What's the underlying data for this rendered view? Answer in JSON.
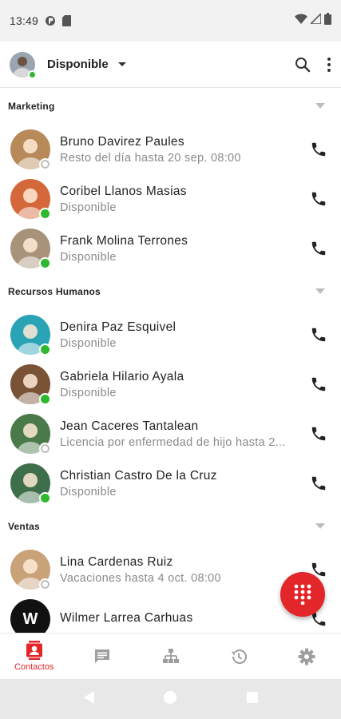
{
  "status_bar": {
    "time": "13:49"
  },
  "header": {
    "status": "Disponible"
  },
  "groups": [
    {
      "name": "Marketing",
      "contacts": [
        {
          "name": "Bruno Davirez Paules",
          "status": "Resto del día hasta 20 sep. 08:00",
          "presence": "off",
          "avatar_color": "#b88a5a"
        },
        {
          "name": "Coribel Llanos Masias",
          "status": "Disponible",
          "presence": "on",
          "avatar_color": "#d4683a"
        },
        {
          "name": "Frank Molina Terrones",
          "status": "Disponible",
          "presence": "on",
          "avatar_color": "#a8937a"
        }
      ]
    },
    {
      "name": "Recursos Humanos",
      "contacts": [
        {
          "name": "Denira Paz Esquivel",
          "status": "Disponible",
          "presence": "on",
          "avatar_color": "#2aa3b5"
        },
        {
          "name": "Gabriela Hilario Ayala",
          "status": "Disponible",
          "presence": "on",
          "avatar_color": "#7a5236"
        },
        {
          "name": "Jean Caceres Tantalean",
          "status": "Licencia por enfermedad de hijo hasta 2...",
          "presence": "off",
          "avatar_color": "#4a7a4a"
        },
        {
          "name": "Christian Castro De la Cruz",
          "status": "Disponible",
          "presence": "on",
          "avatar_color": "#3f6f4a"
        }
      ]
    },
    {
      "name": "Ventas",
      "contacts": [
        {
          "name": "Lina Cardenas Ruiz",
          "status": "Vacaciones hasta 4 oct. 08:00",
          "presence": "off",
          "avatar_color": "#c9a27a"
        },
        {
          "name": "Wilmer Larrea Carhuas",
          "status": "",
          "presence": "none",
          "avatar_color": "#111111",
          "initial": "W"
        }
      ]
    }
  ],
  "bottom_nav": {
    "contacts_label": "Contactos"
  },
  "colors": {
    "accent": "#e3262a",
    "online": "#2db82d"
  }
}
